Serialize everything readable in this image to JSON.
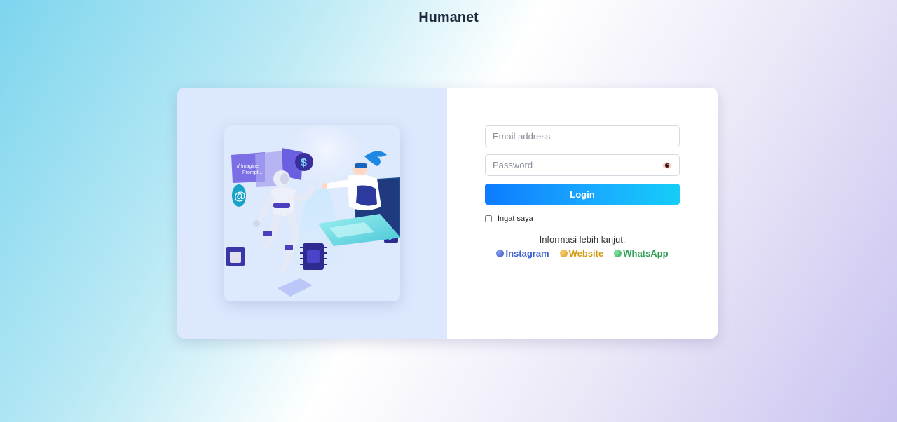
{
  "brand": {
    "title": "Humanet"
  },
  "illustration": {
    "prompt_line1": "// Imagine",
    "prompt_line2": "Prompt..."
  },
  "form": {
    "email_placeholder": "Email address",
    "password_placeholder": "Password",
    "login_label": "Login",
    "remember_label": "Ingat saya",
    "info_label": "Informasi lebih lanjut:"
  },
  "links": [
    {
      "label": "Instagram",
      "color": "#3b5fd0",
      "dot": "#4f72d8"
    },
    {
      "label": "Website",
      "color": "#d49a12",
      "dot": "#e2a82a"
    },
    {
      "label": "WhatsApp",
      "color": "#2f9e55",
      "dot": "#3cbf6a"
    }
  ],
  "colors": {
    "accent": "#0d7bff",
    "card_left_bg": "#dce8fd"
  }
}
